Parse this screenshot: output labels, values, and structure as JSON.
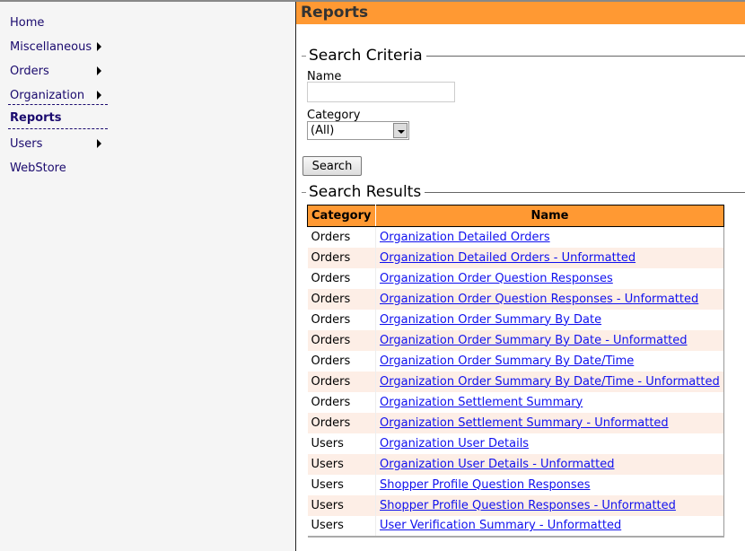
{
  "sidebar": {
    "items": [
      {
        "label": "Home",
        "submenu": false
      },
      {
        "label": "Miscellaneous",
        "submenu": true
      },
      {
        "label": "Orders",
        "submenu": true
      },
      {
        "label": "Organization",
        "submenu": true
      },
      {
        "label": "Reports",
        "submenu": false,
        "active": true
      },
      {
        "label": "Users",
        "submenu": true
      },
      {
        "label": "WebStore",
        "submenu": false
      }
    ]
  },
  "header": {
    "title": "Reports"
  },
  "criteria": {
    "legend": "Search Criteria",
    "name_label": "Name",
    "name_value": "",
    "category_label": "Category",
    "category_value": "(All)",
    "search_label": "Search"
  },
  "results": {
    "legend": "Search Results",
    "columns": [
      "Category",
      "Name"
    ],
    "rows": [
      [
        "Orders",
        "Organization Detailed Orders"
      ],
      [
        "Orders",
        "Organization Detailed Orders - Unformatted"
      ],
      [
        "Orders",
        "Organization Order Question Responses"
      ],
      [
        "Orders",
        "Organization Order Question Responses - Unformatted"
      ],
      [
        "Orders",
        "Organization Order Summary By Date"
      ],
      [
        "Orders",
        "Organization Order Summary By Date - Unformatted"
      ],
      [
        "Orders",
        "Organization Order Summary By Date/Time"
      ],
      [
        "Orders",
        "Organization Order Summary By Date/Time - Unformatted"
      ],
      [
        "Orders",
        "Organization Settlement Summary"
      ],
      [
        "Orders",
        "Organization Settlement Summary - Unformatted"
      ],
      [
        "Users",
        "Organization User Details"
      ],
      [
        "Users",
        "Organization User Details - Unformatted"
      ],
      [
        "Users",
        "Shopper Profile Question Responses"
      ],
      [
        "Users",
        "Shopper Profile Question Responses - Unformatted"
      ],
      [
        "Users",
        "User Verification Summary - Unformatted"
      ]
    ]
  },
  "colors": {
    "accent": "#ff9933",
    "link": "#1010ee",
    "nav": "#1a0a6e",
    "alt_row": "#fdeee6"
  }
}
